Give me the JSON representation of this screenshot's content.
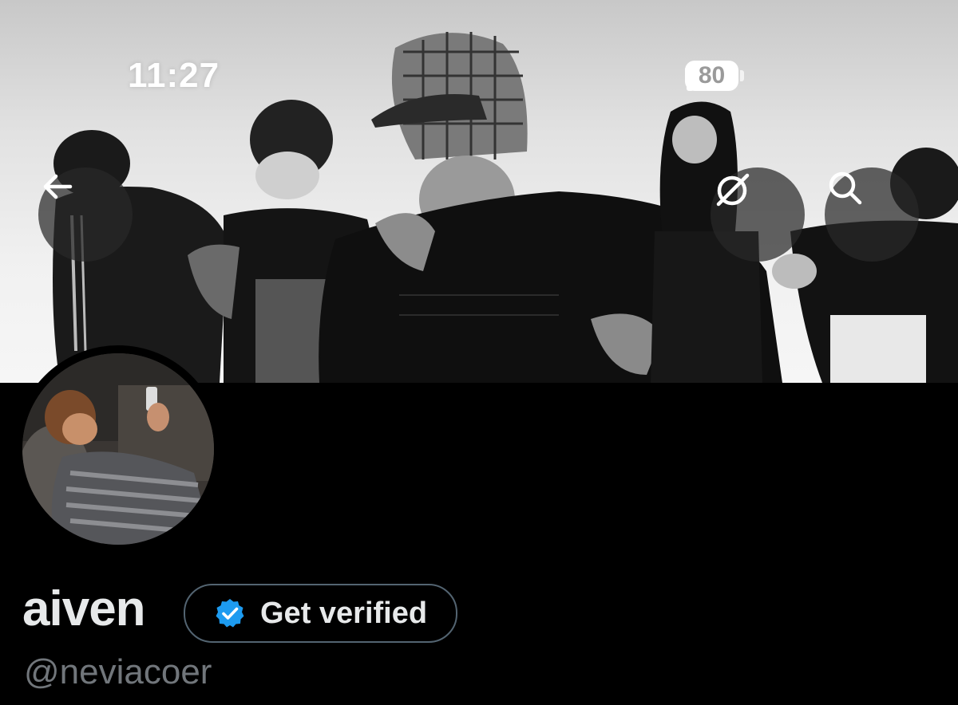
{
  "status_bar": {
    "time": "11:27",
    "battery": "80",
    "icons": [
      "signal-icon",
      "wifi-icon",
      "battery-icon"
    ]
  },
  "header": {
    "back_icon": "arrow-left-icon",
    "grok_icon": "grok-icon",
    "search_icon": "search-icon"
  },
  "profile": {
    "display_name": "aiven",
    "get_verified_label": "Get verified",
    "handle": "@neviacoer"
  },
  "colors": {
    "background": "#000000",
    "verified_badge": "#1d9bf0",
    "text_primary": "#e7e9ea",
    "text_secondary": "#71767b",
    "pill_border": "#536471"
  }
}
